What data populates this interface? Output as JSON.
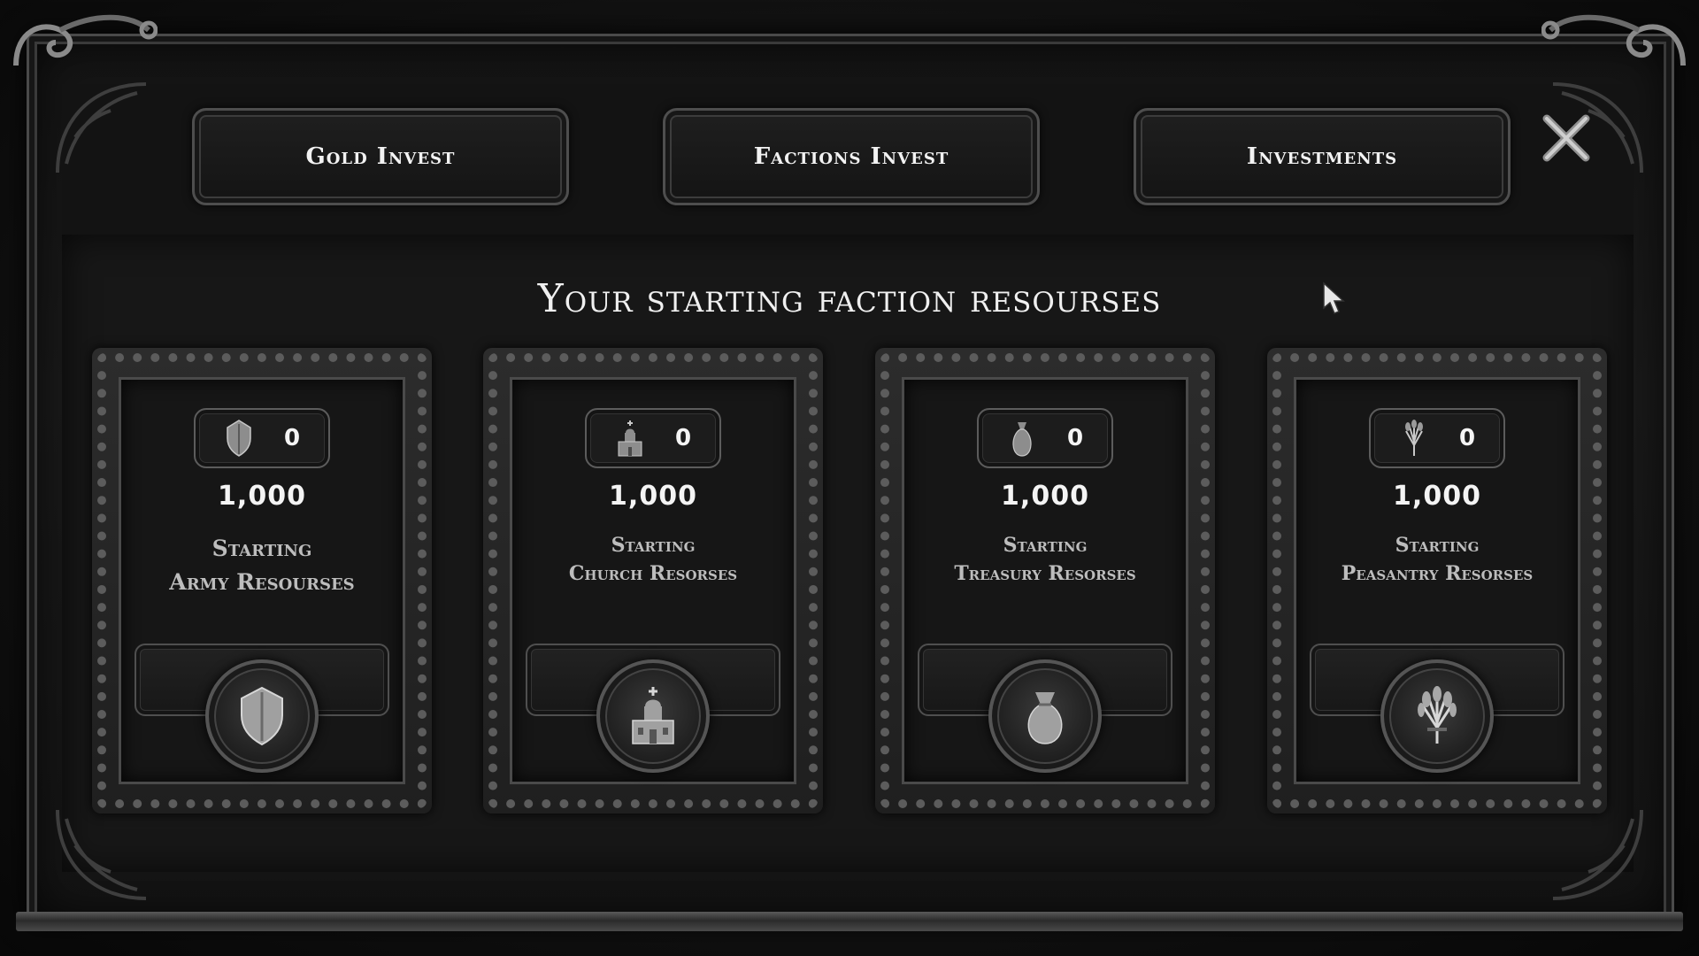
{
  "tabs": [
    {
      "label": "Gold Invest"
    },
    {
      "label": "Factions Invest"
    },
    {
      "label": "Investments"
    }
  ],
  "heading": "Your starting faction resourses",
  "cards": [
    {
      "icon": "shield-icon",
      "count": "0",
      "amount": "1,000",
      "line1": "Starting",
      "line2": "Army Resourses"
    },
    {
      "icon": "church-icon",
      "count": "0",
      "amount": "1,000",
      "line1": "Starting",
      "line2": "Church Resorses"
    },
    {
      "icon": "money-bag-icon",
      "count": "0",
      "amount": "1,000",
      "line1": "Starting",
      "line2": "Treasury Resorses"
    },
    {
      "icon": "wheat-sheaf-icon",
      "count": "0",
      "amount": "1,000",
      "line1": "Starting",
      "line2": "Peasantry Resorses"
    }
  ],
  "colors": {
    "background": "#0c0c0c",
    "frame": "#4a4a4a",
    "text": "#f0f0f0",
    "label": "#bdbdbd"
  }
}
